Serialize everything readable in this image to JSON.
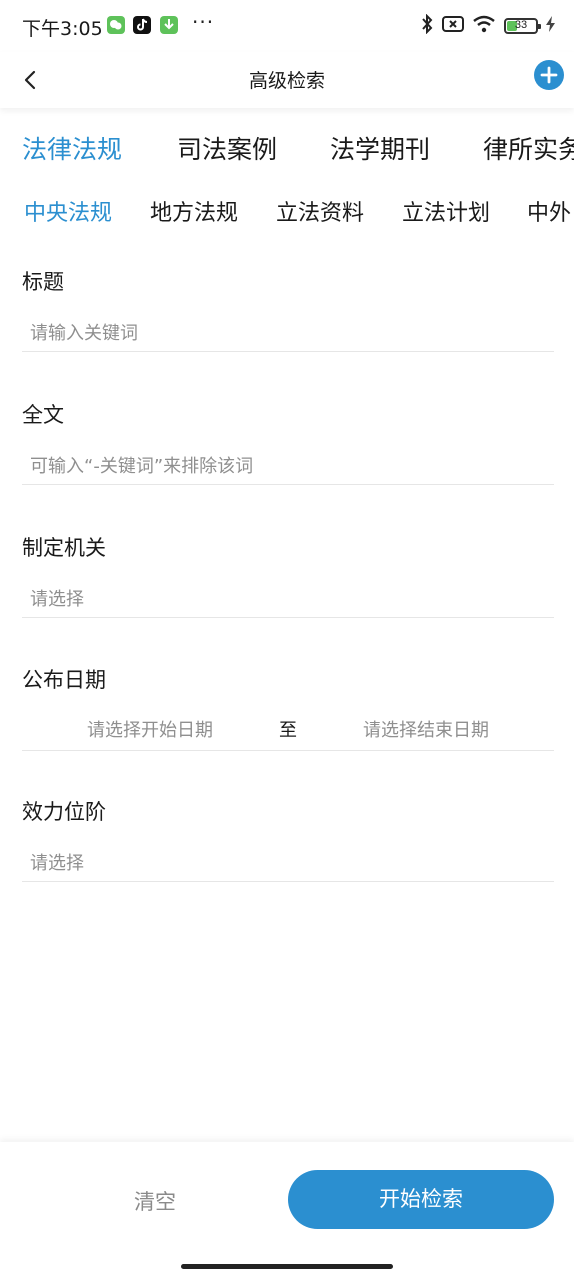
{
  "status_bar": {
    "time": "下午3:05",
    "battery_level": "33",
    "more": "···",
    "icons": [
      "wechat-app-icon",
      "tiktok-app-icon",
      "download-app-icon",
      "bluetooth-icon",
      "sim-off-icon",
      "wifi-icon",
      "battery-icon",
      "charging-icon"
    ]
  },
  "nav": {
    "title": "高级检索",
    "back_icon": "chevron-left-icon",
    "add_icon": "plus-circle-icon"
  },
  "primary_tabs": [
    {
      "label": "法律法规",
      "active": true
    },
    {
      "label": "司法案例",
      "active": false
    },
    {
      "label": "法学期刊",
      "active": false
    },
    {
      "label": "律所实务",
      "active": false
    }
  ],
  "secondary_tabs": [
    {
      "label": "中央法规",
      "active": true
    },
    {
      "label": "地方法规",
      "active": false
    },
    {
      "label": "立法资料",
      "active": false
    },
    {
      "label": "立法计划",
      "active": false
    },
    {
      "label": "中外",
      "active": false
    }
  ],
  "form": {
    "title": {
      "label": "标题",
      "placeholder": "请输入关键词"
    },
    "fulltext": {
      "label": "全文",
      "placeholder": "可输入“-关键词”来排除该词"
    },
    "authority": {
      "label": "制定机关",
      "placeholder": "请选择"
    },
    "publish_date": {
      "label": "公布日期",
      "start_placeholder": "请选择开始日期",
      "separator": "至",
      "end_placeholder": "请选择结束日期"
    },
    "effect_level": {
      "label": "效力位阶",
      "placeholder": "请选择"
    }
  },
  "actions": {
    "clear": "清空",
    "search": "开始检索"
  },
  "colors": {
    "accent": "#2b8fd0",
    "placeholder": "#8f8f8f",
    "text": "#1a1a1a"
  }
}
